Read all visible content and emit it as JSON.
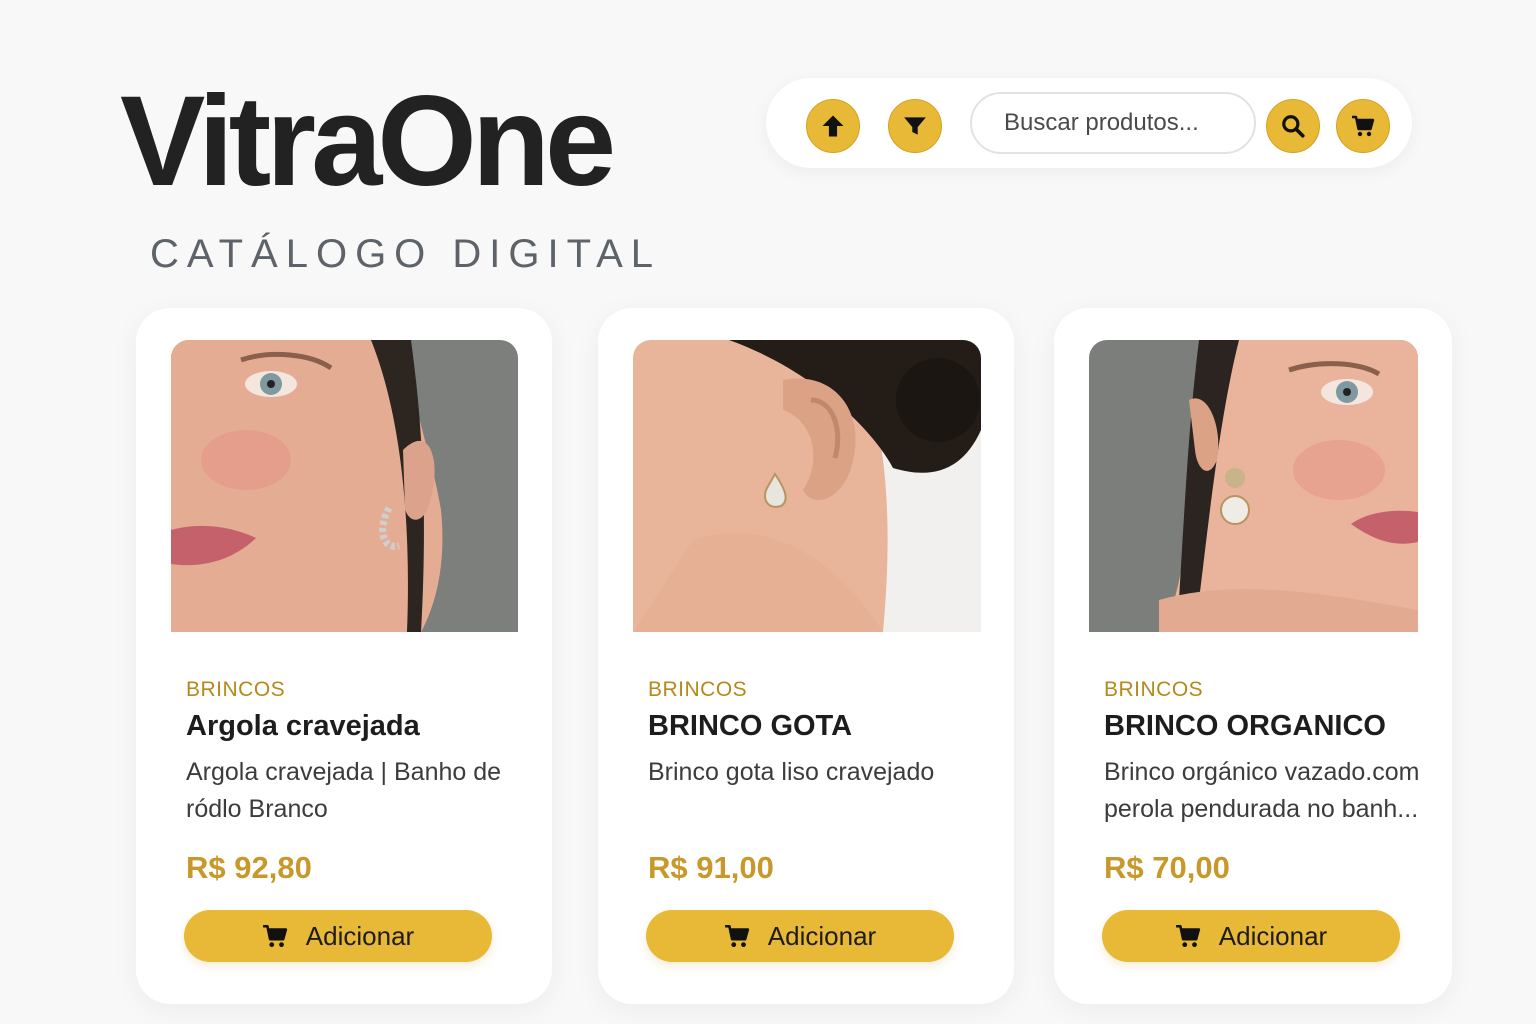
{
  "brand": {
    "title": "VitraOne",
    "subtitle": "CATÁLOGO DIGITAL"
  },
  "toolbar": {
    "sort_icon": "arrow-up-icon",
    "filter_icon": "filter-icon",
    "search": {
      "placeholder": "Buscar produtos..."
    },
    "search_icon": "search-icon",
    "cart_icon": "cart-icon"
  },
  "colors": {
    "accent": "#e8b837",
    "price": "#c9982a",
    "category": "#b5891a"
  },
  "products": [
    {
      "category": "BRINCOS",
      "name": "Argola cravejada",
      "description": "Argola cravejada | Banho de ródlo Branco",
      "price": "R$ 92,80",
      "button_label": "Adicionar"
    },
    {
      "category": "BRINCOS",
      "name": "BRINCO GOTA",
      "description": "Brinco gota liso cravejado",
      "price": "R$ 91,00",
      "button_label": "Adicionar"
    },
    {
      "category": "BRINCOS",
      "name": "BRINCO ORGANICO",
      "description": "Brinco orgánico vazado.com perola pendurada no banh...",
      "price": "R$ 70,00",
      "button_label": "Adicionar"
    }
  ]
}
